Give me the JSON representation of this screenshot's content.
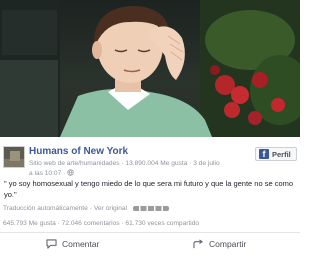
{
  "post": {
    "page_name": "Humans of New York",
    "meta_line1": "Sitio web de arte/humanidades · 13.890.004 Me gusta · 3 de julio",
    "meta_line2": "a las 10:07 · ",
    "profile_button": "Perfil",
    "quote": "\" yo soy homosexual y tengo miedo de lo que sera mi futuro y que la gente no se como yo.\"",
    "translated_label": "Traducción automáticamente",
    "separator": " · ",
    "see_original": "Ver original",
    "stats": "645.793 Me gusta · 72.046 comentarios · 61.730 veces compartido"
  },
  "actions": {
    "comment_label": "Comentar",
    "share_label": "Compartir"
  },
  "icons": {
    "profile_icon": "facebook-f-icon",
    "globe_icon": "globe-icon",
    "comment_icon": "speech-bubble-icon",
    "share_icon": "share-arrow-icon"
  },
  "colors": {
    "link_blue": "#3b5998",
    "meta_gray": "#90949c",
    "body_text": "#1d2129"
  }
}
